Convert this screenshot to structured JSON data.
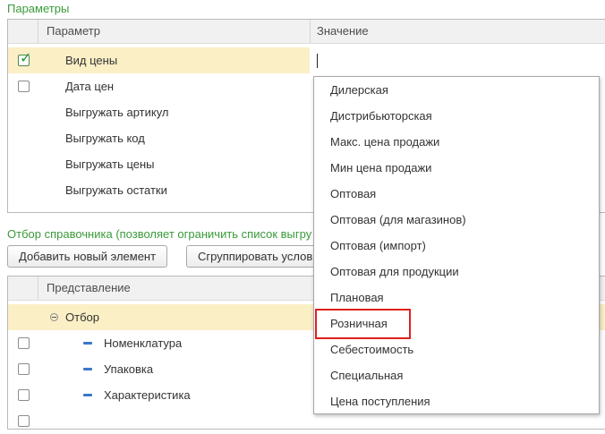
{
  "params_section": {
    "title": "Параметры",
    "columns": {
      "param": "Параметр",
      "value": "Значение"
    },
    "rows": [
      {
        "label": "Вид цены",
        "checkbox": true,
        "checked": true,
        "selected": true
      },
      {
        "label": "Дата цен",
        "checkbox": true,
        "checked": false,
        "selected": false
      },
      {
        "label": "Выгружать артикул",
        "checkbox": false
      },
      {
        "label": "Выгружать код",
        "checkbox": false
      },
      {
        "label": "Выгружать цены",
        "checkbox": false
      },
      {
        "label": "Выгружать остатки",
        "checkbox": false
      }
    ]
  },
  "filter_section": {
    "title": "Отбор справочника (позволяет ограничить список выгру",
    "add_button": "Добавить новый элемент",
    "group_button": "Сгруппировать услов",
    "column": "Представление",
    "rows": [
      {
        "label": "Отбор",
        "icon": "collapse-minus-icon",
        "selected": true
      },
      {
        "label": "Номенклатура",
        "icon": "item-dash-icon",
        "selected": false
      },
      {
        "label": "Упаковка",
        "icon": "item-dash-icon",
        "selected": false
      },
      {
        "label": "Характеристика",
        "icon": "item-dash-icon",
        "selected": false
      }
    ]
  },
  "dropdown": {
    "items": [
      "Дилерская",
      "Дистрибьюторская",
      "Макс. цена продажи",
      "Мин цена продажи",
      "Оптовая",
      "Оптовая (для магазинов)",
      "Оптовая (импорт)",
      "Оптовая для продукции",
      "Плановая",
      "Розничная",
      "Себестоимость",
      "Специальная",
      "Цена поступления"
    ],
    "highlighted": "Розничная"
  },
  "colors": {
    "section_title": "#3a9a3a",
    "selected_row": "#fbefc6",
    "highlight_border": "#e02020",
    "checkmark": "#1d9a2f",
    "dash_icon": "#3b78c9"
  }
}
